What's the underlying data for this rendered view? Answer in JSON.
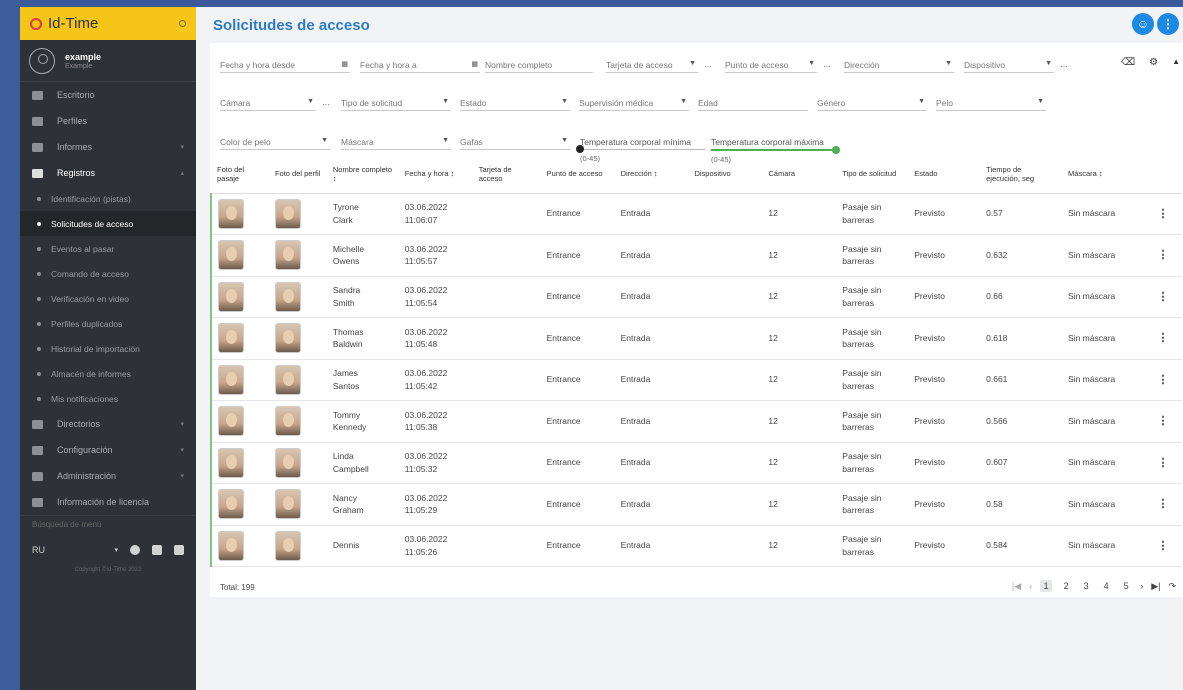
{
  "app": {
    "title": "Id-Time"
  },
  "user": {
    "name": "example",
    "role": "Example"
  },
  "sidebar": {
    "items": [
      {
        "label": "Escritorio",
        "icon": "home-icon"
      },
      {
        "label": "Perfiles",
        "icon": "profile-card-icon"
      },
      {
        "label": "Informes",
        "icon": "report-icon"
      },
      {
        "label": "Registros",
        "icon": "table-icon"
      }
    ],
    "subitems": [
      "Identificación (pistas)",
      "Solicitudes de acceso",
      "Eventos al pasar",
      "Comando de acceso",
      "Verificación en video",
      "Perfiles duplicados",
      "Historial de importación",
      "Almacén de informes",
      "Mis notificaciones"
    ],
    "items2": [
      {
        "label": "Directorios",
        "icon": "list-icon"
      },
      {
        "label": "Configuración",
        "icon": "wrench-icon"
      },
      {
        "label": "Administración",
        "icon": "gear-icon"
      },
      {
        "label": "Información de licencia",
        "icon": "license-icon"
      }
    ],
    "search_placeholder": "Búsqueda de menú",
    "lang": "RU",
    "copyright": "Copyright ©Id-Time 2022"
  },
  "page": {
    "title": "Solicitudes de acceso"
  },
  "filters": {
    "fecha_desde": "Fecha y hora desde",
    "fecha_a": "Fecha y hora a",
    "nombre": "Nombre completo",
    "tarjeta": "Tarjeta de acceso",
    "punto": "Punto de acceso",
    "direccion": "Dirección",
    "dispositivo": "Dispositivo",
    "camara": "Cámara",
    "tipo": "Tipo de solicitud",
    "estado": "Estado",
    "supervision": "Supervisión médica",
    "edad": "Edad",
    "genero": "Género",
    "pelo": "Pelo",
    "color_pelo": "Color de pelo",
    "mascara": "Máscara",
    "gafas": "Gafas",
    "temp_min": "Temperatura corporal mínima",
    "temp_max": "Temperatura corporal máxima",
    "temp_range": "(0-45)"
  },
  "table": {
    "headers": [
      "Foto del pasaje",
      "Foto del perfil",
      "Nombre completo ↕",
      "Fecha y hora ↕",
      "Tarjeta de acceso",
      "Punto de acceso",
      "Dirección ↕",
      "Dispositivo",
      "Cámara",
      "Tipo de solicitud",
      "Estado",
      "Tiempo de ejecución, seg",
      "Máscara ↕"
    ],
    "rows": [
      {
        "first": "Tyrone",
        "last": "Clark",
        "date": "03.06.2022",
        "time": "11:06:07",
        "punto": "Entrance",
        "dir": "Entrada",
        "cam": "12",
        "tipo1": "Pasaje sin",
        "tipo2": "barreras",
        "estado": "Previsto",
        "tiempo": "0.57",
        "mascara": "Sin máscara"
      },
      {
        "first": "Michelle",
        "last": "Owens",
        "date": "03.06.2022",
        "time": "11:05:57",
        "punto": "Entrance",
        "dir": "Entrada",
        "cam": "12",
        "tipo1": "Pasaje sin",
        "tipo2": "barreras",
        "estado": "Previsto",
        "tiempo": "0.632",
        "mascara": "Sin máscara"
      },
      {
        "first": "Sandra",
        "last": "Smith",
        "date": "03.06.2022",
        "time": "11:05:54",
        "punto": "Entrance",
        "dir": "Entrada",
        "cam": "12",
        "tipo1": "Pasaje sin",
        "tipo2": "barreras",
        "estado": "Previsto",
        "tiempo": "0.66",
        "mascara": "Sin máscara"
      },
      {
        "first": "Thomas",
        "last": "Baldwin",
        "date": "03.06.2022",
        "time": "11:05:48",
        "punto": "Entrance",
        "dir": "Entrada",
        "cam": "12",
        "tipo1": "Pasaje sin",
        "tipo2": "barreras",
        "estado": "Previsto",
        "tiempo": "0.618",
        "mascara": "Sin máscara"
      },
      {
        "first": "James",
        "last": "Santos",
        "date": "03.06.2022",
        "time": "11:05:42",
        "punto": "Entrance",
        "dir": "Entrada",
        "cam": "12",
        "tipo1": "Pasaje sin",
        "tipo2": "barreras",
        "estado": "Previsto",
        "tiempo": "0.661",
        "mascara": "Sin máscara"
      },
      {
        "first": "Tommy",
        "last": "Kennedy",
        "date": "03.06.2022",
        "time": "11:05:38",
        "punto": "Entrance",
        "dir": "Entrada",
        "cam": "12",
        "tipo1": "Pasaje sin",
        "tipo2": "barreras",
        "estado": "Previsto",
        "tiempo": "0.566",
        "mascara": "Sin máscara"
      },
      {
        "first": "Linda",
        "last": "Campbell",
        "date": "03.06.2022",
        "time": "11:05:32",
        "punto": "Entrance",
        "dir": "Entrada",
        "cam": "12",
        "tipo1": "Pasaje sin",
        "tipo2": "barreras",
        "estado": "Previsto",
        "tiempo": "0.607",
        "mascara": "Sin máscara"
      },
      {
        "first": "Nancy",
        "last": "Graham",
        "date": "03.06.2022",
        "time": "11:05:29",
        "punto": "Entrance",
        "dir": "Entrada",
        "cam": "12",
        "tipo1": "Pasaje sin",
        "tipo2": "barreras",
        "estado": "Previsto",
        "tiempo": "0.58",
        "mascara": "Sin máscara"
      },
      {
        "first": "Dennis",
        "last": "",
        "date": "03.06.2022",
        "time": "11:05:26",
        "punto": "Entrance",
        "dir": "Entrada",
        "cam": "12",
        "tipo1": "Pasaje sin",
        "tipo2": "barreras",
        "estado": "Previsto",
        "tiempo": "0.584",
        "mascara": "Sin máscara"
      }
    ]
  },
  "footer": {
    "total": "Total: 199",
    "pages": [
      "1",
      "2",
      "3",
      "4",
      "5"
    ]
  },
  "colors": {
    "brand": "#f5c518",
    "accent": "#1e88e5",
    "title": "#2d7bc4",
    "sidebar": "#2e3135"
  }
}
